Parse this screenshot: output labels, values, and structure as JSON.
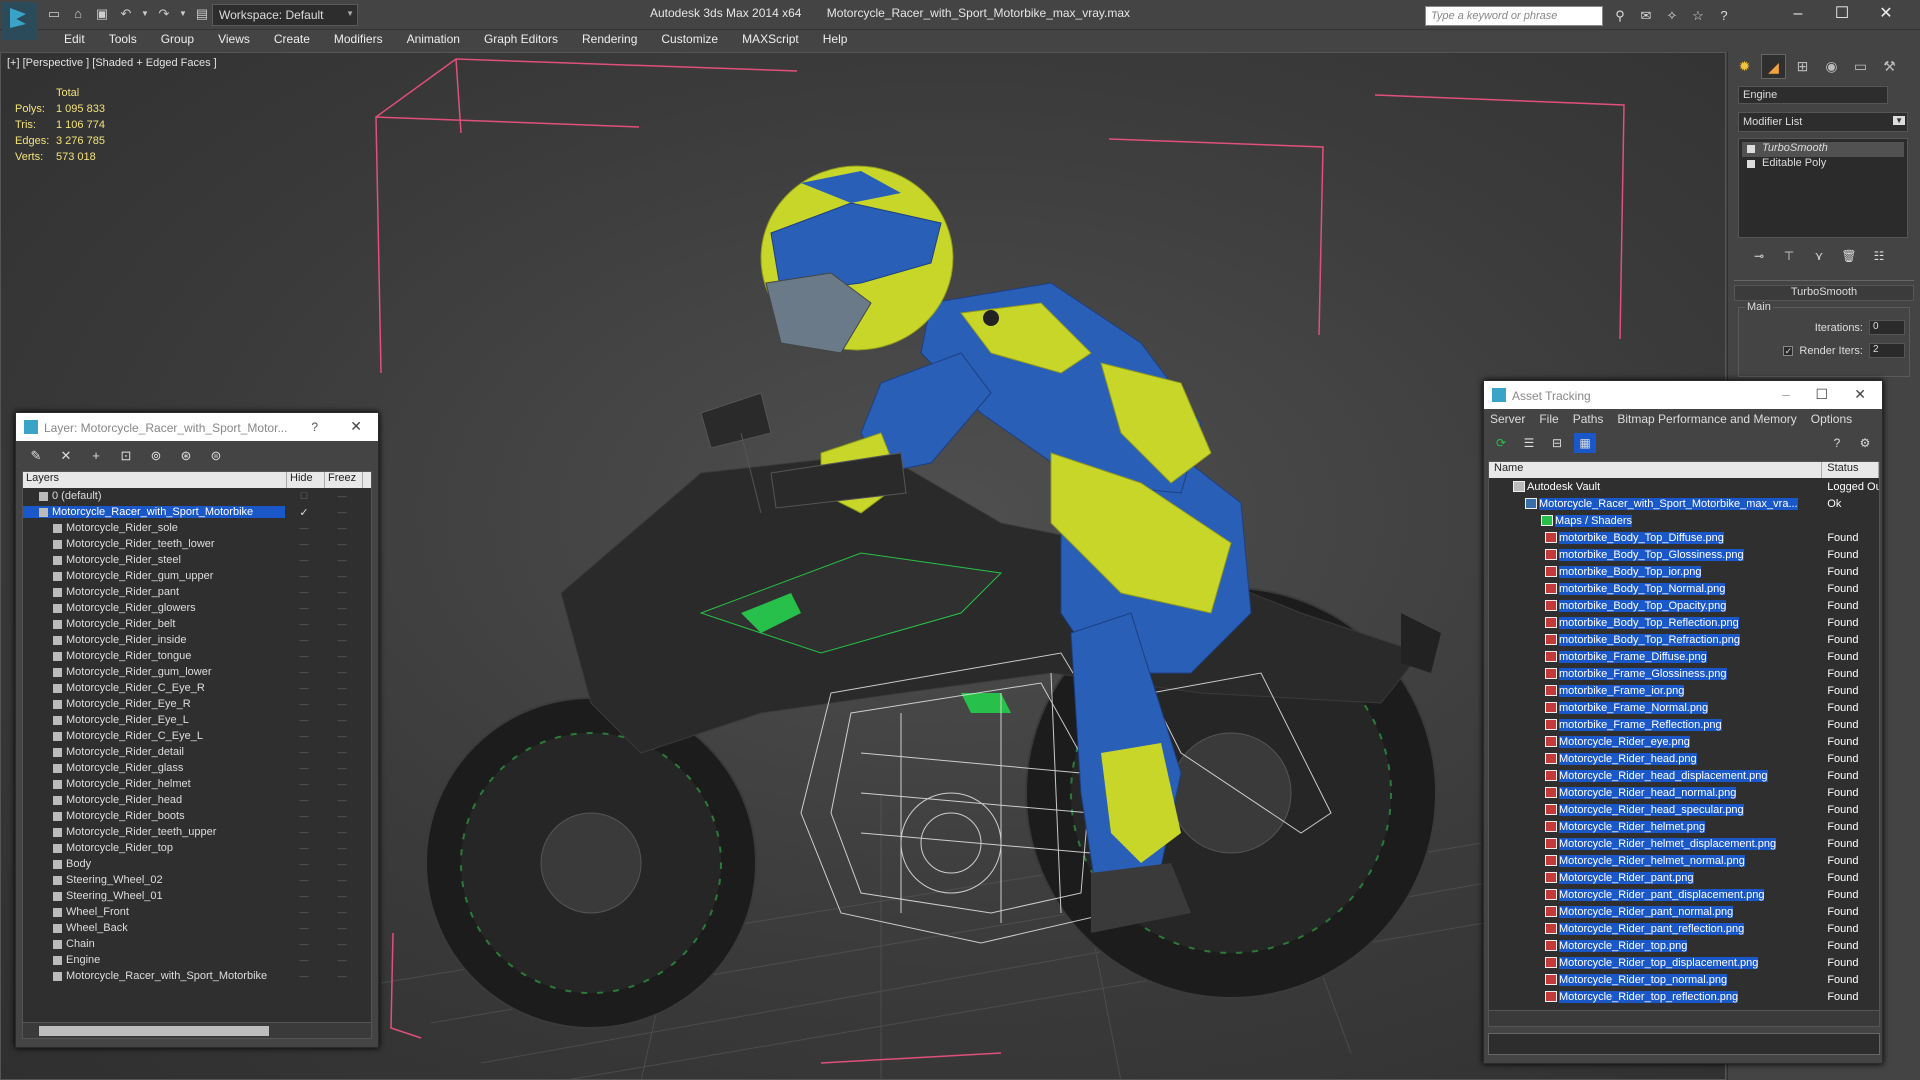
{
  "titlebar": {
    "app": "Autodesk 3ds Max  2014 x64",
    "file": "Motorcycle_Racer_with_Sport_Motorbike_max_vray.max",
    "workspace": "Workspace: Default",
    "search_placeholder": "Type a keyword or phrase"
  },
  "menu": [
    "Edit",
    "Tools",
    "Group",
    "Views",
    "Create",
    "Modifiers",
    "Animation",
    "Graph Editors",
    "Rendering",
    "Customize",
    "MAXScript",
    "Help"
  ],
  "viewport": {
    "label": "[+] [Perspective ] [Shaded + Edged Faces ]",
    "stats": {
      "total_label": "Total",
      "rows": [
        {
          "k": "Polys:",
          "v": "1 095 833"
        },
        {
          "k": "Tris:",
          "v": "1 106 774"
        },
        {
          "k": "Edges:",
          "v": "3 276 785"
        },
        {
          "k": "Verts:",
          "v": "573 018"
        }
      ]
    }
  },
  "command_panel": {
    "object_name": "Engine",
    "modifier_list": "Modifier List",
    "stack": [
      "TurboSmooth",
      "Editable Poly"
    ],
    "rollout_title": "TurboSmooth",
    "group_label": "Main",
    "iterations_label": "Iterations:",
    "iterations_value": "0",
    "render_iters_label": "Render Iters:",
    "render_iters_value": "2"
  },
  "layer_dialog": {
    "title": "Layer: Motorcycle_Racer_with_Sport_Motor...",
    "help": "?",
    "columns": [
      "Layers",
      "Hide",
      "Freez"
    ],
    "default_layer": "0 (default)",
    "selected_layer": "Motorcycle_Racer_with_Sport_Motorbike",
    "objects": [
      "Motorcycle_Rider_sole",
      "Motorcycle_Rider_teeth_lower",
      "Motorcycle_Rider_steel",
      "Motorcycle_Rider_gum_upper",
      "Motorcycle_Rider_pant",
      "Motorcycle_Rider_glowers",
      "Motorcycle_Rider_belt",
      "Motorcycle_Rider_inside",
      "Motorcycle_Rider_tongue",
      "Motorcycle_Rider_gum_lower",
      "Motorcycle_Rider_C_Eye_R",
      "Motorcycle_Rider_Eye_R",
      "Motorcycle_Rider_Eye_L",
      "Motorcycle_Rider_C_Eye_L",
      "Motorcycle_Rider_detail",
      "Motorcycle_Rider_glass",
      "Motorcycle_Rider_helmet",
      "Motorcycle_Rider_head",
      "Motorcycle_Rider_boots",
      "Motorcycle_Rider_teeth_upper",
      "Motorcycle_Rider_top",
      "Body",
      "Steering_Wheel_02",
      "Steering_Wheel_01",
      "Wheel_Front",
      "Wheel_Back",
      "Chain",
      "Engine",
      "Motorcycle_Racer_with_Sport_Motorbike"
    ]
  },
  "asset_dialog": {
    "title": "Asset Tracking",
    "menu": [
      "Server",
      "File",
      "Paths",
      "Bitmap Performance and Memory",
      "Options"
    ],
    "columns": [
      "Name",
      "Status"
    ],
    "vault": {
      "name": "Autodesk Vault",
      "status": "Logged Ou"
    },
    "scene_file": {
      "name": "Motorcycle_Racer_with_Sport_Motorbike_max_vra...",
      "status": "Ok"
    },
    "maps_folder": "Maps / Shaders",
    "found_status": "Found",
    "files": [
      "motorbike_Body_Top_Diffuse.png",
      "motorbike_Body_Top_Glossiness.png",
      "motorbike_Body_Top_ior.png",
      "motorbike_Body_Top_Normal.png",
      "motorbike_Body_Top_Opacity.png",
      "motorbike_Body_Top_Reflection.png",
      "motorbike_Body_Top_Refraction.png",
      "motorbike_Frame_Diffuse.png",
      "motorbike_Frame_Glossiness.png",
      "motorbike_Frame_ior.png",
      "motorbike_Frame_Normal.png",
      "motorbike_Frame_Reflection.png",
      "Motorcycle_Rider_eye.png",
      "Motorcycle_Rider_head.png",
      "Motorcycle_Rider_head_displacement.png",
      "Motorcycle_Rider_head_normal.png",
      "Motorcycle_Rider_head_specular.png",
      "Motorcycle_Rider_helmet.png",
      "Motorcycle_Rider_helmet_displacement.png",
      "Motorcycle_Rider_helmet_normal.png",
      "Motorcycle_Rider_pant.png",
      "Motorcycle_Rider_pant_displacement.png",
      "Motorcycle_Rider_pant_normal.png",
      "Motorcycle_Rider_pant_reflection.png",
      "Motorcycle_Rider_top.png",
      "Motorcycle_Rider_top_displacement.png",
      "Motorcycle_Rider_top_normal.png",
      "Motorcycle_Rider_top_reflection.png"
    ]
  },
  "colors": {
    "bound_box": "#e0507a",
    "suit_yellow": "#c8d629",
    "suit_blue": "#2a5fb8",
    "bike_green": "#27c04a",
    "selection": "#1a57c8"
  }
}
